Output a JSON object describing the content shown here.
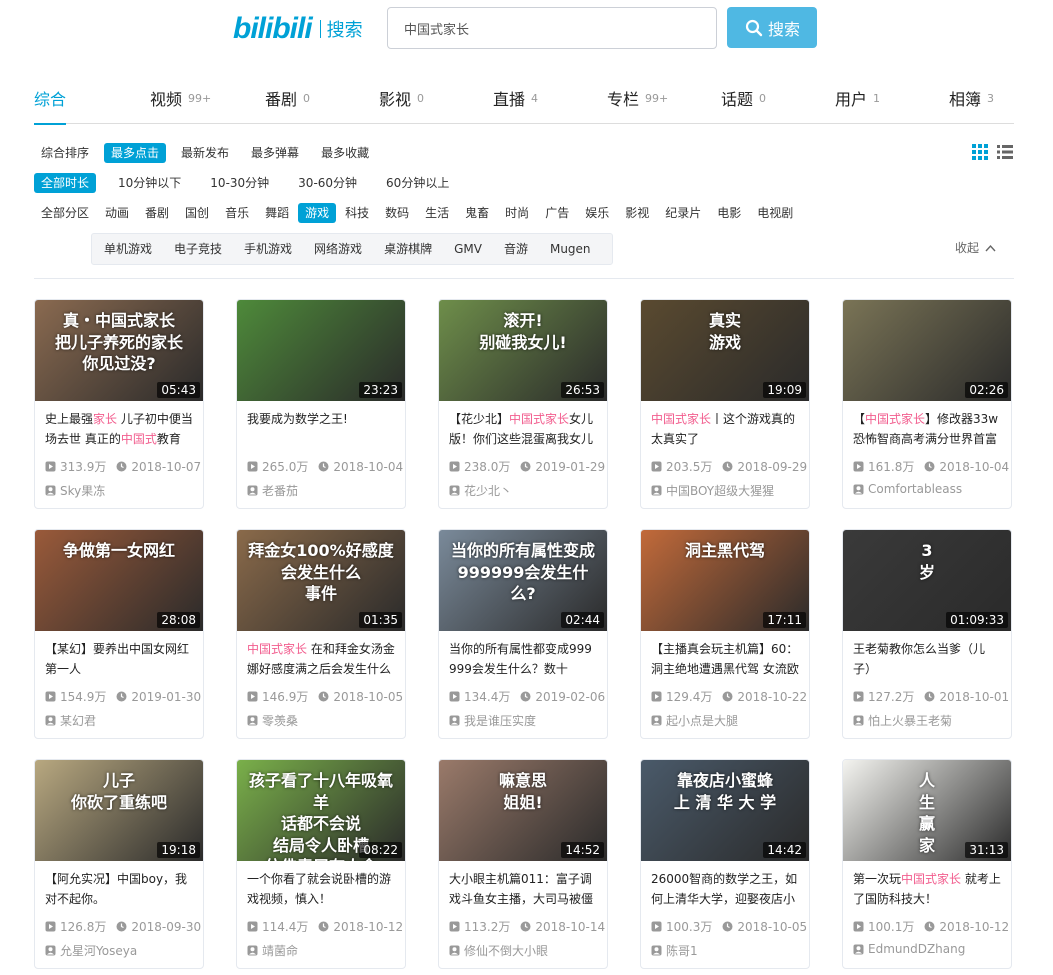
{
  "header": {
    "logo": "bilibili",
    "logo_suffix": "搜索",
    "search_value": "中国式家长",
    "search_button": "搜索"
  },
  "type_tabs": [
    {
      "label": "综合",
      "count": "",
      "active": true
    },
    {
      "label": "视频",
      "count": "99+"
    },
    {
      "label": "番剧",
      "count": "0"
    },
    {
      "label": "影视",
      "count": "0"
    },
    {
      "label": "直播",
      "count": "4"
    },
    {
      "label": "专栏",
      "count": "99+"
    },
    {
      "label": "话题",
      "count": "0"
    },
    {
      "label": "用户",
      "count": "1"
    },
    {
      "label": "相簿",
      "count": "3"
    }
  ],
  "sort_options": [
    "综合排序",
    "最多点击",
    "最新发布",
    "最多弹幕",
    "最多收藏"
  ],
  "sort_active": 1,
  "duration_options": [
    "全部时长",
    "10分钟以下",
    "10-30分钟",
    "30-60分钟",
    "60分钟以上"
  ],
  "duration_active": 0,
  "zone_options": [
    "全部分区",
    "动画",
    "番剧",
    "国创",
    "音乐",
    "舞蹈",
    "游戏",
    "科技",
    "数码",
    "生活",
    "鬼畜",
    "时尚",
    "广告",
    "娱乐",
    "影视",
    "纪录片",
    "电影",
    "电视剧"
  ],
  "zone_active": 6,
  "sub_zones": [
    "单机游戏",
    "电子竞技",
    "手机游戏",
    "网络游戏",
    "桌游棋牌",
    "GMV",
    "音游",
    "Mugen"
  ],
  "collapse_label": "收起",
  "videos": [
    {
      "thumb_text": "真・中国式家长\n把儿子养死的家长\n你见过没?",
      "duration": "05:43",
      "title": [
        [
          "史上最强",
          ""
        ],
        [
          "家长",
          "hl"
        ],
        [
          " 儿子初中便当场去世 真正的",
          ""
        ],
        [
          "中国式",
          "hl"
        ],
        [
          "教育",
          ""
        ]
      ],
      "views": "313.9万",
      "date": "2018-10-07",
      "uploader": "Sky果冻",
      "color": "#8a6a50"
    },
    {
      "thumb_text": "",
      "duration": "23:23",
      "title": [
        [
          "我要成为数学之王!",
          ""
        ]
      ],
      "views": "265.0万",
      "date": "2018-10-04",
      "uploader": "老番茄",
      "color": "#4e8a3a"
    },
    {
      "thumb_text": "滚开!\n别碰我女儿!",
      "duration": "26:53",
      "title": [
        [
          "【花少北】",
          ""
        ],
        [
          "中国式家长",
          "hl"
        ],
        [
          "女儿版！你们这些混蛋离我女儿",
          ""
        ]
      ],
      "views": "238.0万",
      "date": "2019-01-29",
      "uploader": "花少北丶",
      "color": "#6e8e4a"
    },
    {
      "thumb_text": "真实\n游戏",
      "duration": "19:09",
      "title": [
        [
          "中国式家长",
          "hl"
        ],
        [
          "丨这个游戏真的太真实了",
          ""
        ]
      ],
      "views": "203.5万",
      "date": "2018-09-29",
      "uploader": "中国BOY超级大猩猩",
      "color": "#5a4a30"
    },
    {
      "thumb_text": "",
      "duration": "02:26",
      "title": [
        [
          "【",
          ""
        ],
        [
          "中国式家长",
          "hl"
        ],
        [
          "】修改器33w恐怖智商高考满分世界首富",
          ""
        ]
      ],
      "views": "161.8万",
      "date": "2018-10-04",
      "uploader": "Comfortableass",
      "color": "#7a7456"
    },
    {
      "thumb_text": "争做第一女网红",
      "duration": "28:08",
      "title": [
        [
          "【某幻】要养出中国女网红第一人",
          ""
        ]
      ],
      "views": "154.9万",
      "date": "2019-01-30",
      "uploader": "某幻君",
      "color": "#9a5a3a"
    },
    {
      "thumb_text": "拜金女100%好感度\n会发生什么\n事件",
      "duration": "01:35",
      "title": [
        [
          "中国式家长",
          "hl"
        ],
        [
          " 在和拜金女汤金娜好感度满之后会发生什么",
          ""
        ]
      ],
      "views": "146.9万",
      "date": "2018-10-05",
      "uploader": "零羡桑",
      "color": "#8a6a4a"
    },
    {
      "thumb_text": "当你的所有属性变成999999会发生什么?",
      "duration": "02:44",
      "title": [
        [
          "当你的所有属性都变成999999会发生什么？数十",
          ""
        ]
      ],
      "views": "134.4万",
      "date": "2019-02-06",
      "uploader": "我是谁压实度",
      "color": "#7a8a9a"
    },
    {
      "thumb_text": "洞主黑代驾",
      "duration": "17:11",
      "title": [
        [
          "【主播真会玩主机篇】60：洞主绝地遭遇黑代驾 女流欧",
          ""
        ]
      ],
      "views": "129.4万",
      "date": "2018-10-22",
      "uploader": "起小点是大腿",
      "color": "#c26a3a"
    },
    {
      "thumb_text": "3\n岁",
      "duration": "01:09:33",
      "title": [
        [
          "王老菊教你怎么当爹（儿子）",
          ""
        ]
      ],
      "views": "127.2万",
      "date": "2018-10-01",
      "uploader": "怕上火暴王老菊",
      "color": "#3a3a3a"
    },
    {
      "thumb_text": "儿子\n你砍了重练吧",
      "duration": "19:18",
      "title": [
        [
          "【阿允实况】中国boy，我对不起你。",
          ""
        ]
      ],
      "views": "126.8万",
      "date": "2018-09-30",
      "uploader": "允星河Yoseya",
      "color": "#b8a880"
    },
    {
      "thumb_text": "孩子看了十八年吸氧羊\n话都不会说\n结局令人卧槽\n仿佛青居有人舍",
      "duration": "08:22",
      "title": [
        [
          "一个你看了就会说卧槽的游戏视频，慎入！",
          ""
        ]
      ],
      "views": "114.4万",
      "date": "2018-10-12",
      "uploader": "靖菌命",
      "color": "#7ab04a"
    },
    {
      "thumb_text": "嘛意思\n姐姐!",
      "duration": "14:52",
      "title": [
        [
          "大小眼主机篇011：富子调戏斗鱼女主播，大司马被僵",
          ""
        ]
      ],
      "views": "113.2万",
      "date": "2018-10-14",
      "uploader": "修仙不倒大小眼",
      "color": "#9a7a6a"
    },
    {
      "thumb_text": "靠夜店小蜜蜂\n上 清 华 大 学",
      "duration": "14:42",
      "title": [
        [
          "26000智商的数学之王，如何上清华大学，迎娶夜店小",
          ""
        ]
      ],
      "views": "100.3万",
      "date": "2018-10-05",
      "uploader": "陈哥1",
      "color": "#4a5a6a"
    },
    {
      "thumb_text": "人\n生\n赢\n家",
      "duration": "31:13",
      "title": [
        [
          "第一次玩",
          ""
        ],
        [
          "中国式家长",
          "hl"
        ],
        [
          " 就考上了国防科技大！",
          ""
        ]
      ],
      "views": "100.1万",
      "date": "2018-10-12",
      "uploader": "EdmundDZhang",
      "color": "#f4f4f0"
    }
  ]
}
